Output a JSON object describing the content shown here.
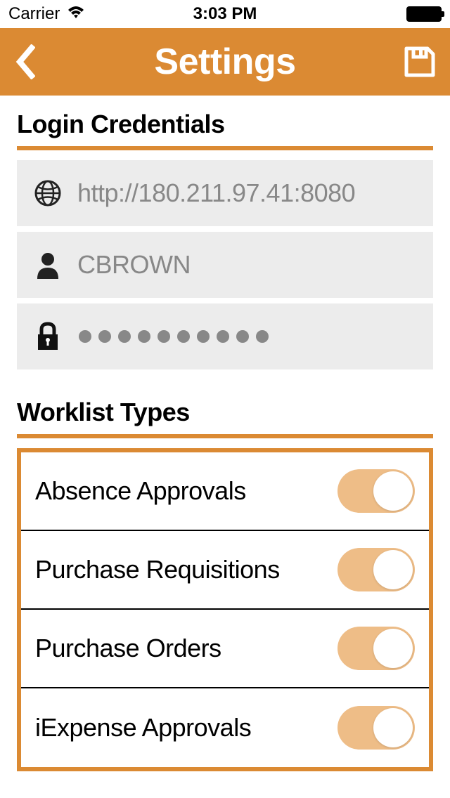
{
  "statusBar": {
    "carrier": "Carrier",
    "time": "3:03 PM"
  },
  "nav": {
    "title": "Settings"
  },
  "credentials": {
    "sectionTitle": "Login Credentials",
    "url": "http://180.211.97.41:8080",
    "username": "CBROWN",
    "passwordLength": 10
  },
  "worklist": {
    "sectionTitle": "Worklist Types",
    "items": [
      {
        "label": "Absence Approvals",
        "enabled": true
      },
      {
        "label": "Purchase Requisitions",
        "enabled": true
      },
      {
        "label": "Purchase Orders",
        "enabled": true
      },
      {
        "label": "iExpense Approvals",
        "enabled": true
      }
    ]
  }
}
